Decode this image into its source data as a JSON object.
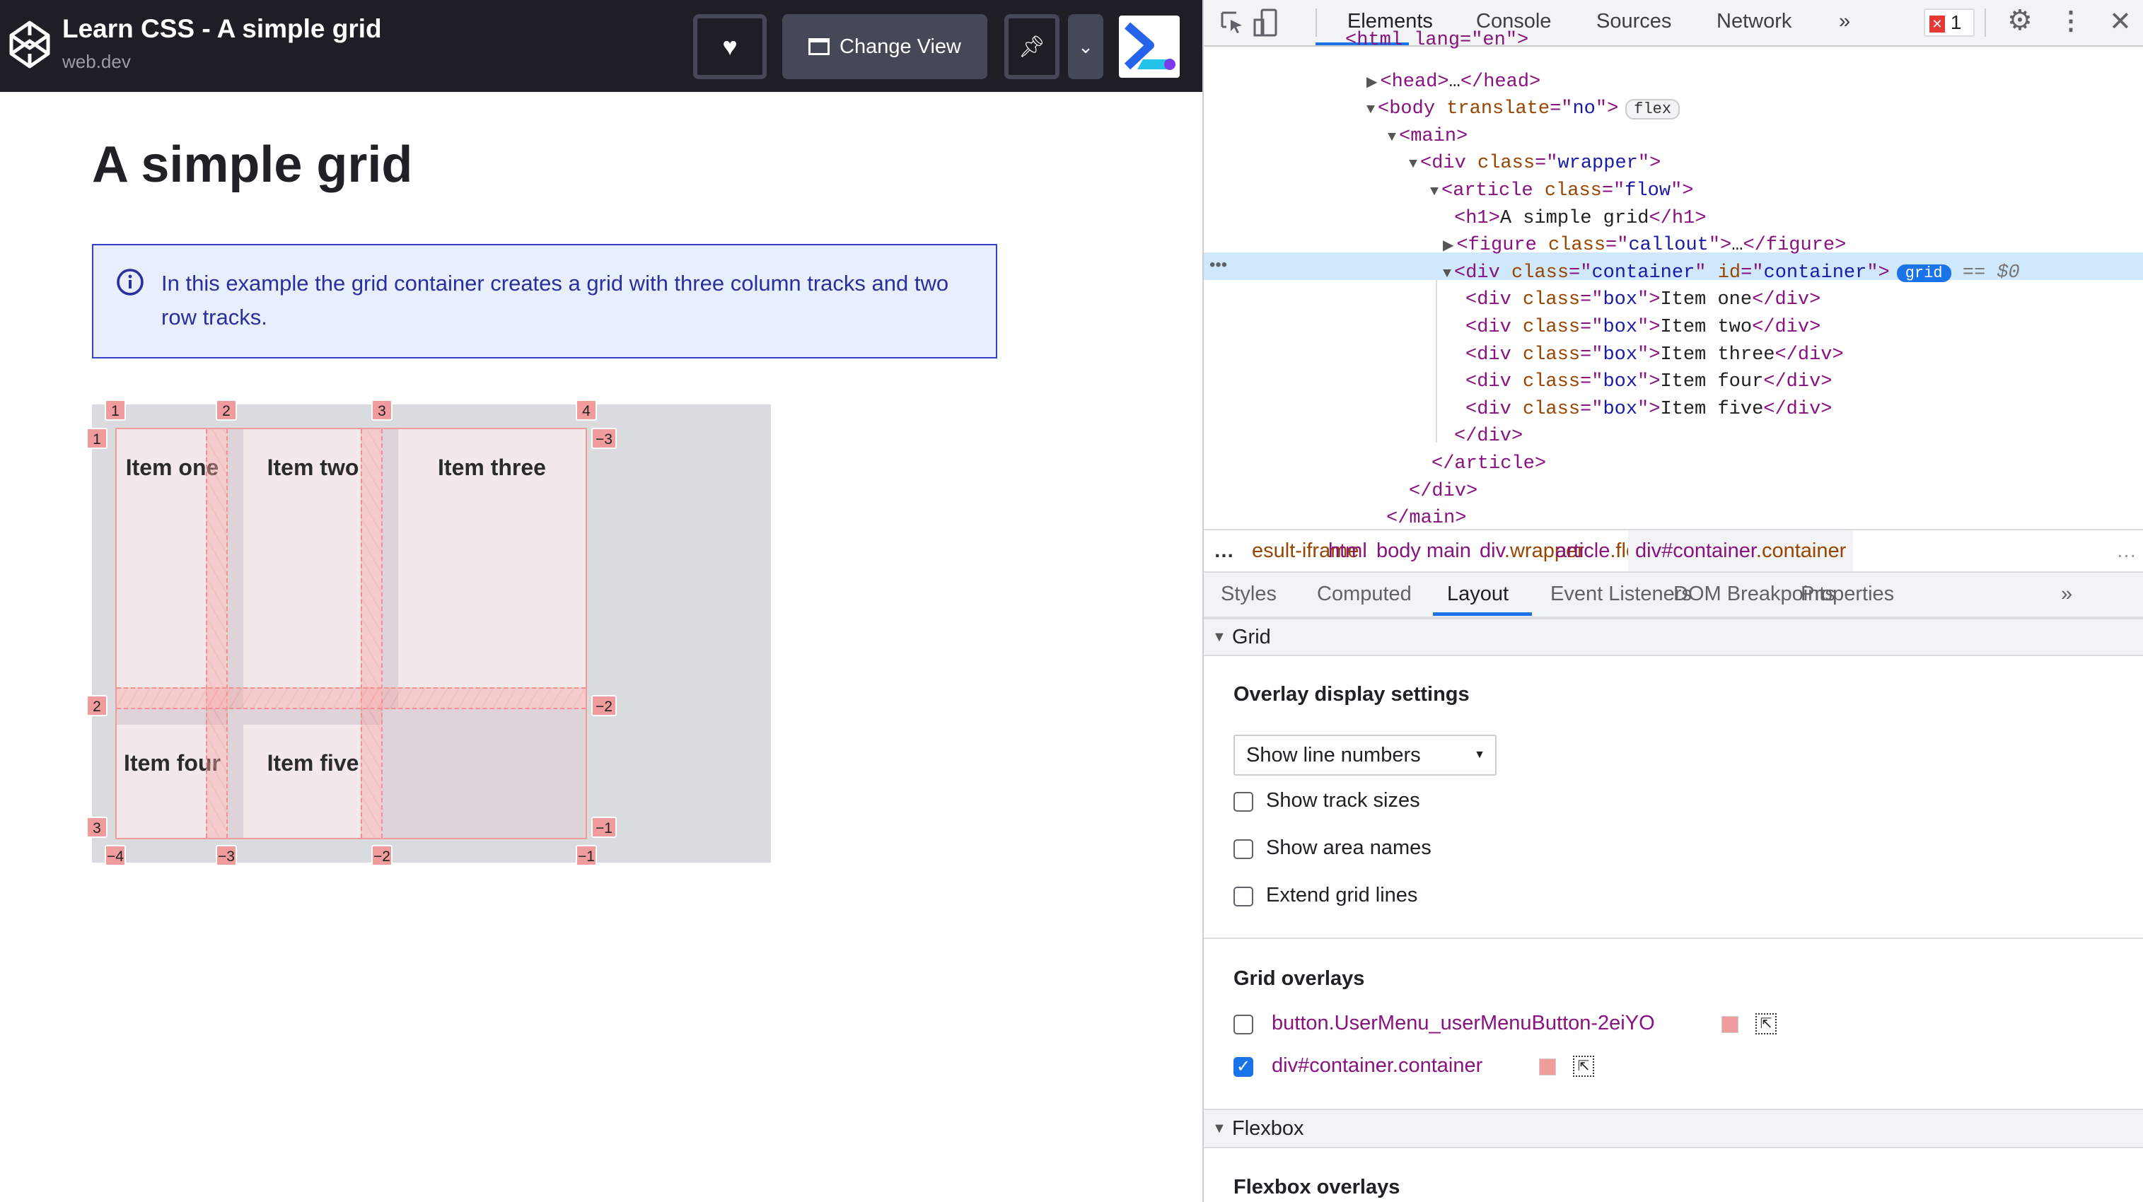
{
  "header": {
    "title": "Learn CSS - A simple grid",
    "subtitle": "web.dev",
    "change_view": "Change View",
    "icons": [
      "codepen-logo-icon",
      "heart-icon",
      "window-icon",
      "pin-icon",
      "chevron-down-icon",
      "app-logo-icon"
    ]
  },
  "page": {
    "title": "A simple grid",
    "callout": "In this example the grid container creates a grid with three column tracks and two row tracks.",
    "items": [
      "Item one",
      "Item two",
      "Item three",
      "Item four",
      "Item five"
    ],
    "line_numbers": {
      "top": [
        "1",
        "2",
        "3",
        "4"
      ],
      "left": [
        "1",
        "2",
        "3"
      ],
      "right": [
        "-3",
        "-2",
        "-1"
      ],
      "bottom": [
        "-4",
        "-3",
        "-2",
        "-1"
      ]
    },
    "overlay_color": "#f19c9c"
  },
  "devtools": {
    "tabs": [
      "Elements",
      "Console",
      "Sources",
      "Network",
      "»"
    ],
    "active_tab": "Elements",
    "error_count": "1",
    "dom": [
      [
        [
          "t",
          "<html lang=\"en\">"
        ]
      ],
      [
        [
          "tri",
          "▶"
        ],
        [
          "t",
          "<head>"
        ],
        [
          "tx",
          "…"
        ],
        [
          "t",
          "</head>"
        ]
      ],
      [
        [
          "tri",
          "▼"
        ],
        [
          "t",
          "<body "
        ],
        [
          "an",
          "translate"
        ],
        [
          "t",
          "=\""
        ],
        [
          "av",
          "no"
        ],
        [
          "t",
          "\">"
        ],
        [
          "badge",
          "flex"
        ]
      ],
      [
        [
          "tri",
          "▼"
        ],
        [
          "t",
          "<main>"
        ]
      ],
      [
        [
          "tri",
          "▼"
        ],
        [
          "t",
          "<div "
        ],
        [
          "an",
          "class"
        ],
        [
          "t",
          "=\""
        ],
        [
          "av",
          "wrapper"
        ],
        [
          "t",
          "\">"
        ]
      ],
      [
        [
          "tri",
          "▼"
        ],
        [
          "t",
          "<article "
        ],
        [
          "an",
          "class"
        ],
        [
          "t",
          "=\""
        ],
        [
          "av",
          "flow"
        ],
        [
          "t",
          "\">"
        ]
      ],
      [
        [
          "t",
          "<h1>"
        ],
        [
          "tx",
          "A simple grid"
        ],
        [
          "t",
          "</h1>"
        ]
      ],
      [
        [
          "tri",
          "▶"
        ],
        [
          "t",
          "<figure "
        ],
        [
          "an",
          "class"
        ],
        [
          "t",
          "=\""
        ],
        [
          "av",
          "callout"
        ],
        [
          "t",
          "\">"
        ],
        [
          "tx",
          "…"
        ],
        [
          "t",
          "</figure>"
        ]
      ],
      [
        [
          "tri",
          "▼"
        ],
        [
          "t",
          "<div "
        ],
        [
          "an",
          "class"
        ],
        [
          "t",
          "=\""
        ],
        [
          "av",
          "container"
        ],
        [
          "t",
          "\" "
        ],
        [
          "an",
          "id"
        ],
        [
          "t",
          "=\""
        ],
        [
          "av",
          "container"
        ],
        [
          "t",
          "\">"
        ],
        [
          "gbadge",
          "grid"
        ],
        [
          "eq",
          " == $0"
        ]
      ],
      [
        [
          "t",
          "<div "
        ],
        [
          "an",
          "class"
        ],
        [
          "t",
          "=\""
        ],
        [
          "av",
          "box"
        ],
        [
          "t",
          "\">"
        ],
        [
          "tx",
          "Item one"
        ],
        [
          "t",
          "</div>"
        ]
      ],
      [
        [
          "t",
          "<div "
        ],
        [
          "an",
          "class"
        ],
        [
          "t",
          "=\""
        ],
        [
          "av",
          "box"
        ],
        [
          "t",
          "\">"
        ],
        [
          "tx",
          "Item two"
        ],
        [
          "t",
          "</div>"
        ]
      ],
      [
        [
          "t",
          "<div "
        ],
        [
          "an",
          "class"
        ],
        [
          "t",
          "=\""
        ],
        [
          "av",
          "box"
        ],
        [
          "t",
          "\">"
        ],
        [
          "tx",
          "Item three"
        ],
        [
          "t",
          "</div>"
        ]
      ],
      [
        [
          "t",
          "<div "
        ],
        [
          "an",
          "class"
        ],
        [
          "t",
          "=\""
        ],
        [
          "av",
          "box"
        ],
        [
          "t",
          "\">"
        ],
        [
          "tx",
          "Item four"
        ],
        [
          "t",
          "</div>"
        ]
      ],
      [
        [
          "t",
          "<div "
        ],
        [
          "an",
          "class"
        ],
        [
          "t",
          "=\""
        ],
        [
          "av",
          "box"
        ],
        [
          "t",
          "\">"
        ],
        [
          "tx",
          "Item five"
        ],
        [
          "t",
          "</div>"
        ]
      ],
      [
        [
          "t",
          "</div>"
        ]
      ],
      [
        [
          "t",
          "</article>"
        ]
      ],
      [
        [
          "t",
          "</div>"
        ]
      ],
      [
        [
          "t",
          "</main>"
        ]
      ]
    ],
    "breadcrumbs": [
      "esult-iframe",
      "html",
      "body",
      "main",
      "div.wrapper",
      "article.flow",
      "div#container.container"
    ],
    "sidebar_tabs": [
      "Styles",
      "Computed",
      "Layout",
      "Event Listeners",
      "DOM Breakpoints",
      "Properties",
      "»"
    ],
    "active_sidebar_tab": "Layout",
    "grid_section": "Grid",
    "overlay_settings_title": "Overlay display settings",
    "line_select": "Show line numbers",
    "options": [
      {
        "label": "Show track sizes",
        "checked": false
      },
      {
        "label": "Show area names",
        "checked": false
      },
      {
        "label": "Extend grid lines",
        "checked": false
      }
    ],
    "grid_overlays_title": "Grid overlays",
    "overlays": [
      {
        "label": "button.UserMenu_userMenuButton-2eiYO",
        "checked": false,
        "color": "#f19c9c"
      },
      {
        "label": "div#container.container",
        "checked": true,
        "color": "#f19c9c"
      }
    ],
    "flexbox_section": "Flexbox",
    "flexbox_overlays_title": "Flexbox overlays"
  }
}
